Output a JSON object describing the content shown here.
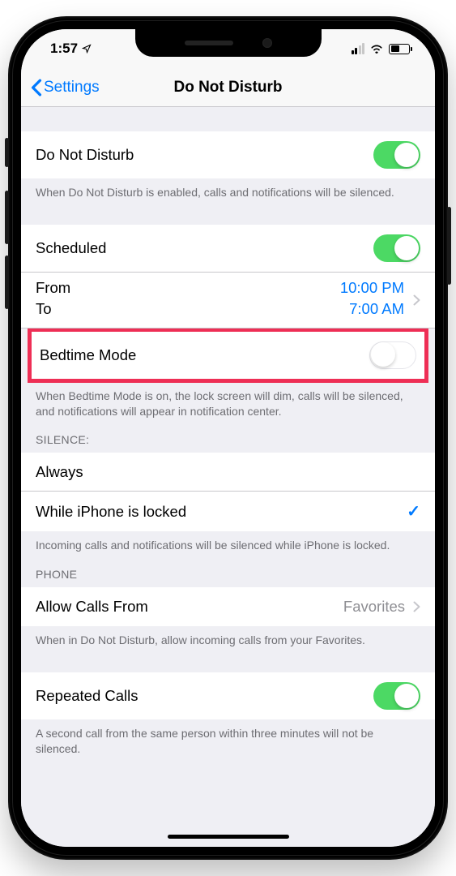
{
  "status": {
    "time": "1:57"
  },
  "nav": {
    "back_label": "Settings",
    "title": "Do Not Disturb"
  },
  "dnd": {
    "label": "Do Not Disturb",
    "enabled": true,
    "footer": "When Do Not Disturb is enabled, calls and notifications will be silenced."
  },
  "scheduled": {
    "label": "Scheduled",
    "enabled": true,
    "from_label": "From",
    "from_value": "10:00 PM",
    "to_label": "To",
    "to_value": "7:00 AM"
  },
  "bedtime": {
    "label": "Bedtime Mode",
    "enabled": false,
    "footer": "When Bedtime Mode is on, the lock screen will dim, calls will be silenced, and notifications will appear in notification center."
  },
  "silence": {
    "header": "SILENCE:",
    "always_label": "Always",
    "locked_label": "While iPhone is locked",
    "selected": "locked",
    "footer": "Incoming calls and notifications will be silenced while iPhone is locked."
  },
  "phone": {
    "header": "PHONE",
    "allow_label": "Allow Calls From",
    "allow_value": "Favorites",
    "allow_footer": "When in Do Not Disturb, allow incoming calls from your Favorites."
  },
  "repeated": {
    "label": "Repeated Calls",
    "enabled": true,
    "footer": "A second call from the same person within three minutes will not be silenced."
  },
  "colors": {
    "accent": "#007aff",
    "toggle_on": "#4cd964",
    "highlight": "#ee2e55"
  }
}
